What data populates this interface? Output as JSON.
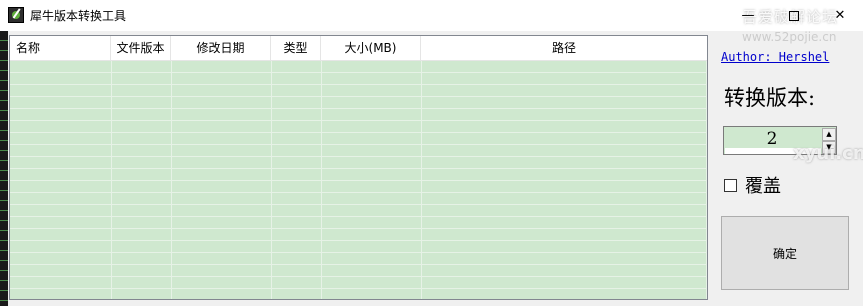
{
  "window": {
    "title": "犀牛版本转换工具",
    "controls": {
      "minimize": "—",
      "close": "✕"
    }
  },
  "watermark": {
    "line1": "吾爱破解论坛",
    "line2": "www.52pojie.cn",
    "line3": "xyui.cn"
  },
  "table": {
    "columns": [
      "名称",
      "文件版本",
      "修改日期",
      "类型",
      "大小(MB)",
      "路径"
    ],
    "rows": []
  },
  "sidebar": {
    "author_link": "Author: Hershel",
    "version_label": "转换版本:",
    "version_value": "2",
    "overwrite_label": "覆盖",
    "overwrite_checked": false,
    "confirm_button": "确定"
  },
  "colors": {
    "list_background": "#cfe8cf",
    "link": "#0000cc"
  }
}
